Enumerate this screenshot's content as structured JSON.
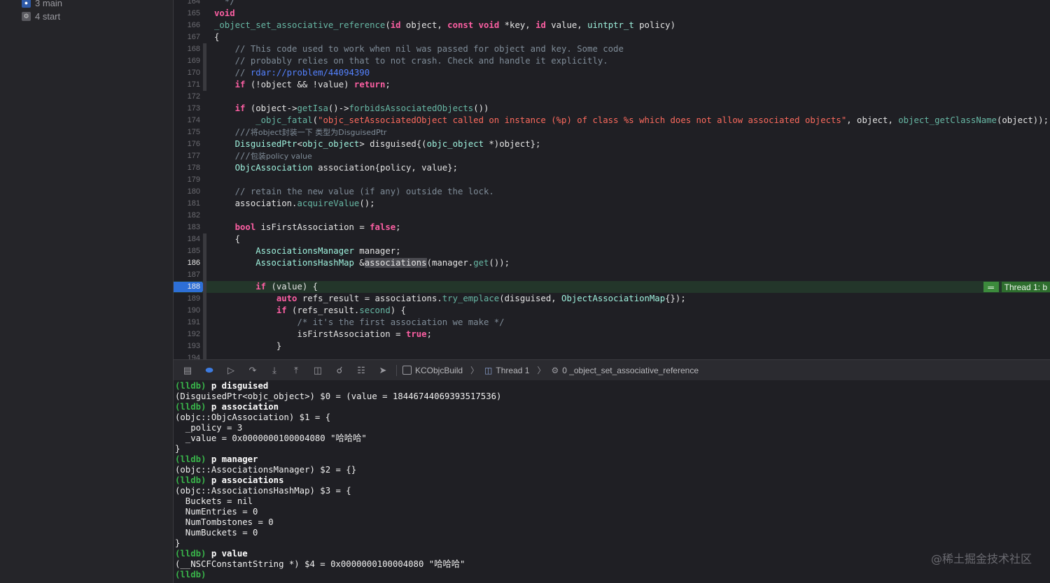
{
  "navigator": {
    "items": [
      {
        "label": "3 main"
      },
      {
        "label": "4 start"
      }
    ]
  },
  "editor": {
    "current_line": "188",
    "thread_badge": "Thread 1: b",
    "lines": [
      {
        "n": "164",
        "t": "  */"
      },
      {
        "n": "165",
        "t": "void"
      },
      {
        "n": "166",
        "t": "_object_set_associative_reference(id object, const void *key, id value, uintptr_t policy)"
      },
      {
        "n": "167",
        "t": "{"
      },
      {
        "n": "168",
        "t": "    // This code used to work when nil was passed for object and key. Some code"
      },
      {
        "n": "169",
        "t": "    // probably relies on that to not crash. Check and handle it explicitly."
      },
      {
        "n": "170",
        "t": "    // rdar://problem/44094390"
      },
      {
        "n": "171",
        "t": "    if (!object && !value) return;"
      },
      {
        "n": "172",
        "t": ""
      },
      {
        "n": "173",
        "t": "    if (object->getIsa()->forbidsAssociatedObjects())"
      },
      {
        "n": "174",
        "t": "        _objc_fatal(\"objc_setAssociatedObject called on instance (%p) of class %s which does not allow associated objects\", object, object_getClassName(object));"
      },
      {
        "n": "175",
        "t": "    ///将object封装一下 类型为DisguisedPtr"
      },
      {
        "n": "176",
        "t": "    DisguisedPtr<objc_object> disguised{(objc_object *)object};"
      },
      {
        "n": "177",
        "t": "    ///包装policy value"
      },
      {
        "n": "178",
        "t": "    ObjcAssociation association{policy, value};"
      },
      {
        "n": "179",
        "t": ""
      },
      {
        "n": "180",
        "t": "    // retain the new value (if any) outside the lock."
      },
      {
        "n": "181",
        "t": "    association.acquireValue();"
      },
      {
        "n": "182",
        "t": ""
      },
      {
        "n": "183",
        "t": "    bool isFirstAssociation = false;"
      },
      {
        "n": "184",
        "t": "    {"
      },
      {
        "n": "185",
        "t": "        AssociationsManager manager;"
      },
      {
        "n": "186",
        "t": "        AssociationsHashMap &associations(manager.get());"
      },
      {
        "n": "187",
        "t": ""
      },
      {
        "n": "188",
        "t": "        if (value) {"
      },
      {
        "n": "189",
        "t": "            auto refs_result = associations.try_emplace(disguised, ObjectAssociationMap{});"
      },
      {
        "n": "190",
        "t": "            if (refs_result.second) {"
      },
      {
        "n": "191",
        "t": "                /* it's the first association we make */"
      },
      {
        "n": "192",
        "t": "                isFirstAssociation = true;"
      },
      {
        "n": "193",
        "t": "            }"
      },
      {
        "n": "194",
        "t": ""
      }
    ]
  },
  "debug_bar": {
    "target": "KCObjcBuild",
    "thread": "Thread 1",
    "frame": "0 _object_set_associative_reference"
  },
  "console": {
    "lines": [
      {
        "prompt": "(lldb)",
        "cmd": "p disguised"
      },
      {
        "out": "(DisguisedPtr<objc_object>) $0 = (value = 18446744069393517536)"
      },
      {
        "prompt": "(lldb)",
        "cmd": "p association"
      },
      {
        "out": "(objc::ObjcAssociation) $1 = {"
      },
      {
        "out": "  _policy = 3"
      },
      {
        "out": "  _value = 0x0000000100004080 \"哈哈哈\""
      },
      {
        "out": "}"
      },
      {
        "prompt": "(lldb)",
        "cmd": "p manager"
      },
      {
        "out": "(objc::AssociationsManager) $2 = {}"
      },
      {
        "prompt": "(lldb)",
        "cmd": "p associations"
      },
      {
        "out": "(objc::AssociationsHashMap) $3 = {"
      },
      {
        "out": "  Buckets = nil"
      },
      {
        "out": "  NumEntries = 0"
      },
      {
        "out": "  NumTombstones = 0"
      },
      {
        "out": "  NumBuckets = 0"
      },
      {
        "out": "}"
      },
      {
        "prompt": "(lldb)",
        "cmd": "p value"
      },
      {
        "out": "(__NSCFConstantString *) $4 = 0x0000000100004080 \"哈哈哈\""
      },
      {
        "prompt": "(lldb)",
        "cmd": ""
      }
    ]
  },
  "watermark": "@稀土掘金技术社区"
}
